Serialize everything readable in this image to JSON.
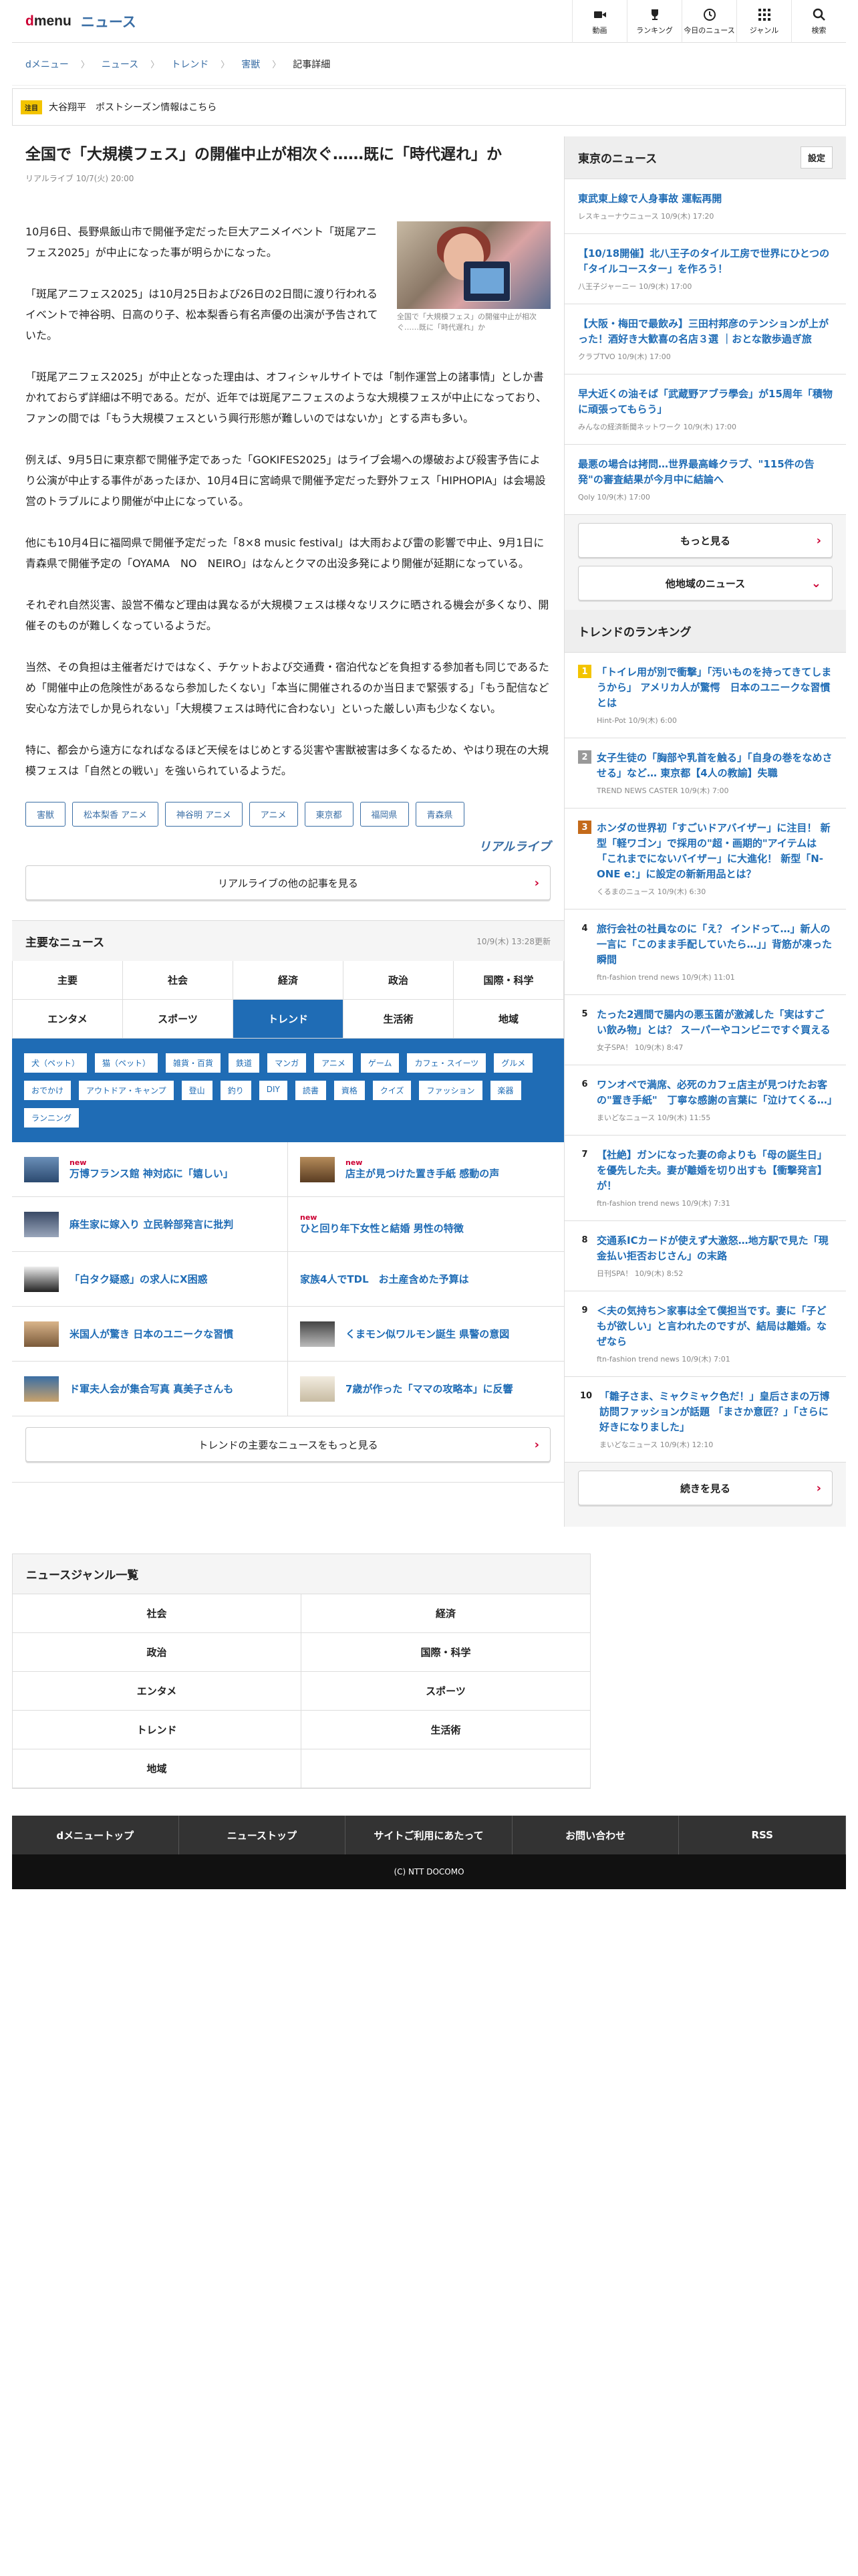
{
  "header": {
    "logo_d": "d",
    "logo_menu": "menu",
    "section": "ニュース",
    "nav": [
      {
        "icon": "video-icon",
        "label": "動画"
      },
      {
        "icon": "trophy-icon",
        "label": "ランキング"
      },
      {
        "icon": "clock-icon",
        "label": "今日のニュース"
      },
      {
        "icon": "grid-icon",
        "label": "ジャンル"
      },
      {
        "icon": "search-icon",
        "label": "検索"
      }
    ]
  },
  "breadcrumb": [
    "dメニュー",
    "ニュース",
    "トレンド",
    "害獣",
    "記事詳細"
  ],
  "notice": {
    "badge": "注目",
    "text": "大谷翔平　ポストシーズン情報はこちら"
  },
  "article": {
    "title": "全国で「大規模フェス」の開催中止が相次ぐ……既に「時代遅れ」か",
    "meta": "リアルライブ 10/7(火) 20:00",
    "photo_caption": "全国で「大規模フェス」の開催中止が相次ぐ……既に「時代遅れ」か",
    "paragraphs": [
      "10月6日、長野県飯山市で開催予定だった巨大アニメイベント「斑尾アニフェス2025」が中止になった事が明らかになった。",
      "「斑尾アニフェス2025」は10月25日および26日の2日間に渡り行われるイベントで神谷明、日高のり子、松本梨香ら有名声優の出演が予告されていた。",
      "「斑尾アニフェス2025」が中止となった理由は、オフィシャルサイトでは「制作運営上の諸事情」としか書かれておらず詳細は不明である。だが、近年では斑尾アニフェスのような大規模フェスが中止になっており、ファンの間では「もう大規模フェスという興行形態が難しいのではないか」とする声も多い。",
      "例えば、9月5日に東京都で開催予定であった「GOKIFES2025」はライブ会場への爆破および殺害予告により公演が中止する事件があったほか、10月4日に宮崎県で開催予定だった野外フェス「HIPHOPIA」は会場設営のトラブルにより開催が中止になっている。",
      "他にも10月4日に福岡県で開催予定だった「8×8 music festival」は大雨および雷の影響で中止、9月1日に青森県で開催予定の「OYAMA　NO　NEIRO」はなんとクマの出没多発により開催が延期になっている。",
      "それぞれ自然災害、設営不備など理由は異なるが大規模フェスは様々なリスクに晒される機会が多くなり、開催そのものが難しくなっているようだ。",
      "当然、その負担は主催者だけではなく、チケットおよび交通費・宿泊代などを負担する参加者も同じであるため「開催中止の危険性があるなら参加したくない」「本当に開催されるのか当日まで緊張する」「もう配信など安心な方法でしか見られない」「大規模フェスは時代に合わない」といった厳しい声も少なくない。",
      "特に、都会から遠方になればなるほど天候をはじめとする災害や害獣被害は多くなるため、やはり現在の大規模フェスは「自然との戦い」を強いられているようだ。"
    ],
    "tags": [
      "害獣",
      "松本梨香 アニメ",
      "神谷明 アニメ",
      "アニメ",
      "東京都",
      "福岡県",
      "青森県"
    ],
    "source_logo": "リアルライブ",
    "more_button": "リアルライブの他の記事を見る"
  },
  "main_news": {
    "title": "主要なニュース",
    "updated": "10/9(木) 13:28更新",
    "tabs": [
      "主要",
      "社会",
      "経済",
      "政治",
      "国際・科学",
      "エンタメ",
      "スポーツ",
      "トレンド",
      "生活術",
      "地域"
    ],
    "active_tab": "トレンド",
    "chips": [
      "犬（ペット）",
      "猫（ペット）",
      "雑貨・百貨",
      "鉄道",
      "マンガ",
      "アニメ",
      "ゲーム",
      "カフェ・スイーツ",
      "グルメ",
      "おでかけ",
      "アウトドア・キャンプ",
      "登山",
      "釣り",
      "DIY",
      "読書",
      "資格",
      "クイズ",
      "ファッション",
      "楽器",
      "ランニング"
    ],
    "items": [
      {
        "new": true,
        "text": "万博フランス館 神対応に「嬉しい」",
        "thumb": true
      },
      {
        "new": true,
        "text": "店主が見つけた置き手紙 感動の声",
        "thumb": true
      },
      {
        "new": false,
        "text": "麻生家に嫁入り 立民幹部発言に批判",
        "thumb": true
      },
      {
        "new": true,
        "text": "ひと回り年下女性と結婚 男性の特徴",
        "thumb": false
      },
      {
        "new": false,
        "text": "「白タク疑惑」の求人にX困惑",
        "thumb": true
      },
      {
        "new": false,
        "text": "家族4人でTDL　お土産含めた予算は",
        "thumb": false
      },
      {
        "new": false,
        "text": "米国人が驚き 日本のユニークな習慣",
        "thumb": true
      },
      {
        "new": false,
        "text": "くまモン似ワルモン誕生 県警の意図",
        "thumb": true
      },
      {
        "new": false,
        "text": "ド軍夫人会が集合写真 真美子さんも",
        "thumb": true
      },
      {
        "new": false,
        "text": "7歳が作った「ママの攻略本」に反響",
        "thumb": true
      }
    ],
    "more_button": "トレンドの主要なニュースをもっと見る"
  },
  "genre": {
    "title": "ニュースジャンル一覧",
    "items": [
      "社会",
      "経済",
      "政治",
      "国際・科学",
      "エンタメ",
      "スポーツ",
      "トレンド",
      "生活術",
      "地域"
    ]
  },
  "footer": {
    "links": [
      "dメニュートップ",
      "ニューストップ",
      "サイトご利用にあたって",
      "お問い合わせ",
      "RSS"
    ],
    "copyright": "(C) NTT DOCOMO"
  },
  "local_news": {
    "title": "東京のニュース",
    "setting": "設定",
    "items": [
      {
        "t": "東武東上線で人身事故 運転再開",
        "s": "レスキューナウニュース 10/9(木) 17:20"
      },
      {
        "t": "【10/18開催】北八王子のタイル工房で世界にひとつの「タイルコースター」を作ろう！",
        "s": "八王子ジャーニー 10/9(木) 17:00"
      },
      {
        "t": "【大阪・梅田で最飲み】三田村邦彦のテンションが上がった！酒好き大歓喜の名店３選 ｜おとな散歩過ぎ旅",
        "s": "クラブTVO 10/9(木) 17:00"
      },
      {
        "t": "早大近くの油そば「武蔵野アブラ學会」が15周年「積物に頑張ってもらう」",
        "s": "みんなの経済新聞ネットワーク 10/9(木) 17:00"
      },
      {
        "t": "最悪の場合は拷問…世界最高峰クラブ、\"115件の告発\"の審査結果が今月中に結論へ",
        "s": "Qoly 10/9(木) 17:00"
      }
    ],
    "more": "もっと見る",
    "other": "他地域のニュース"
  },
  "ranking": {
    "title": "トレンドのランキング",
    "items": [
      {
        "n": "1",
        "t": "「トイレ用が別で衝撃」「汚いものを持ってきてしまうから」 アメリカ人が驚愕　日本のユニークな習慣とは",
        "s": "Hint-Pot 10/9(木) 6:00"
      },
      {
        "n": "2",
        "t": "女子生徒の「胸部や乳首を触る」「自身の巻をなめさせる」など… 東京都【4人の教諭】失職",
        "s": "TREND NEWS CASTER 10/9(木) 7:00"
      },
      {
        "n": "3",
        "t": "ホンダの世界初「すごいドアバイザー」に注目！ 新型「軽ワゴン」で採用の\"超・画期的\"アイテムは「これまでにないバイザー」に大進化！ 新型「N-ONE e：」に設定の新新用品とは？",
        "s": "くるまのニュース 10/9(木) 6:30"
      },
      {
        "n": "4",
        "t": "旅行会社の社員なのに「え？ インドって…」新人の一言に「このまま手配していたら…」」背筋が凍った瞬間",
        "s": "ftn-fashion trend news 10/9(木) 11:01"
      },
      {
        "n": "5",
        "t": "たった2週間で腸内の悪玉菌が激減した「実はすごい飲み物」とは？ スーパーやコンビニですぐ買える",
        "s": "女子SPA！ 10/9(木) 8:47"
      },
      {
        "n": "6",
        "t": "ワンオペで満席、必死のカフェ店主が見つけたお客の\"置き手紙\"　丁寧な感謝の言葉に「泣けてくる…」",
        "s": "まいどなニュース 10/9(木) 11:55"
      },
      {
        "n": "7",
        "t": "【社絶】ガンになった妻の命よりも「母の誕生日」を優先した夫。妻が離婚を切り出すも【衝撃発言】が！",
        "s": "ftn-fashion trend news 10/9(木) 7:31"
      },
      {
        "n": "8",
        "t": "交通系ICカードが使えず大激怒…地方駅で見た「現金払い拒否おじさん」の末路",
        "s": "日刊SPA！ 10/9(木) 8:52"
      },
      {
        "n": "9",
        "t": "＜夫の気持ち＞家事は全て僕担当です。妻に「子どもが欲しい」と言われたのですが、結局は離婚。なぜなら",
        "s": "ftn-fashion trend news 10/9(木) 7:01"
      },
      {
        "n": "10",
        "t": "「雛子さま、ミャクミャク色だ！」皇后さまの万博訪問ファッションが話題 「まさか意匠？」「さらに好きになりました」",
        "s": "まいどなニュース 10/9(木) 12:10"
      }
    ],
    "more": "続きを見る"
  }
}
